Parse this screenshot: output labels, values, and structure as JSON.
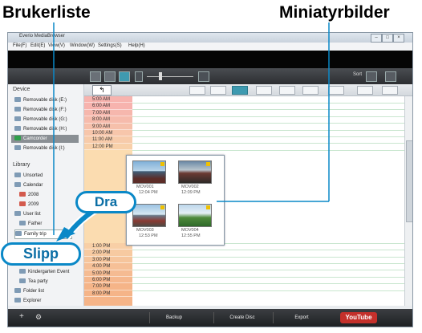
{
  "callouts": {
    "left": "Brukerliste",
    "right": "Miniatyrbilder",
    "drag": "Dra",
    "drop": "Slipp"
  },
  "window": {
    "title": "Everio MediaBrowser",
    "buttons": [
      "–",
      "□",
      "×"
    ]
  },
  "menu": [
    "File(F)",
    "Edit(E)",
    "View(V)",
    "Window(W)",
    "Settings(S)",
    "Help(H)"
  ],
  "toolbar": {
    "right_label": "Sort"
  },
  "sidebar": {
    "device_header": "Device",
    "devices": [
      "Removable disk (E:)",
      "Removable disk (F:)",
      "Removable disk (G:)",
      "Removable disk (H:)",
      "Camcorder",
      "Removable disk (I:)"
    ],
    "library_header": "Library",
    "library": [
      "Unsorted",
      "Calendar",
      "2008",
      "2009",
      "User list",
      "Father",
      "Family trip",
      "Kindergarten Event",
      "Tea party",
      "Folder list",
      "Explorer"
    ]
  },
  "nav": {
    "back": "↰"
  },
  "times_top": [
    "5:00 AM",
    "6:00 AM",
    "7:00 AM",
    "8:00 AM",
    "9:00 AM",
    "10:00 AM",
    "11:00 AM",
    "12:00 PM"
  ],
  "times_bottom": [
    "1:00 PM",
    "2:00 PM",
    "3:00 PM",
    "4:00 PM",
    "5:00 PM",
    "6:00 PM",
    "7:00 PM",
    "8:00 PM"
  ],
  "thumbnails": [
    {
      "name": "MOV001",
      "time": "12:04 PM"
    },
    {
      "name": "MOV002",
      "time": "12:09 PM"
    },
    {
      "name": "MOV003",
      "time": "12:53 PM"
    },
    {
      "name": "MOV004",
      "time": "12:55 PM"
    }
  ],
  "bottom": {
    "add": "+",
    "settings": "⚙",
    "buttons": [
      "Backup",
      "Create Disc",
      "Export"
    ],
    "youtube": "YouTube"
  },
  "colors": {
    "accent": "#0a88c7",
    "timeline_morning": "#f7b3ae",
    "timeline_afternoon": "#f5b488",
    "grid": "#c9e6cf"
  }
}
